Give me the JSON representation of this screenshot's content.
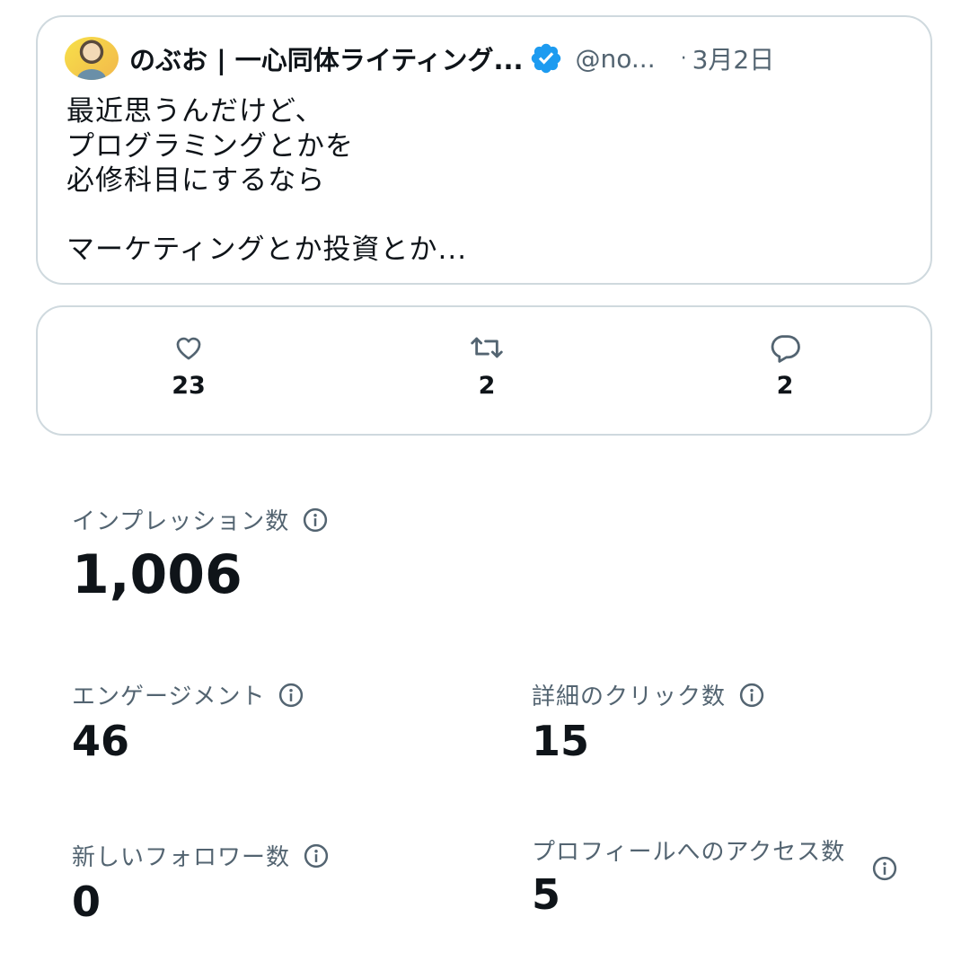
{
  "tweet": {
    "author_name": "のぶお | 一心同体ライティング...",
    "handle": "@no...",
    "separator": "·",
    "date": "3月2日",
    "lines": [
      "最近思うんだけど、",
      "プログラミングとかを",
      "必修科目にするなら",
      "",
      "マーケティングとか投資とか..."
    ]
  },
  "actions": {
    "likes": "23",
    "retweets": "2",
    "replies": "2"
  },
  "metrics": {
    "impressions": {
      "label": "インプレッション数",
      "value": "1,006"
    },
    "engagement": {
      "label": "エンゲージメント",
      "value": "46"
    },
    "detail_clicks": {
      "label": "詳細のクリック数",
      "value": "15"
    },
    "new_followers": {
      "label": "新しいフォロワー数",
      "value": "0"
    },
    "profile_visits": {
      "label": "プロフィールへのアクセス数",
      "value": "5"
    }
  },
  "colors": {
    "text_primary": "#0f1419",
    "text_secondary": "#536471",
    "border": "#cfd9de",
    "verified_blue": "#1d9bf0"
  },
  "icons": {
    "avatar": "avatar",
    "verified": "verified-badge-icon",
    "like": "heart-icon",
    "retweet": "retweet-icon",
    "reply": "reply-icon",
    "info": "info-icon"
  }
}
